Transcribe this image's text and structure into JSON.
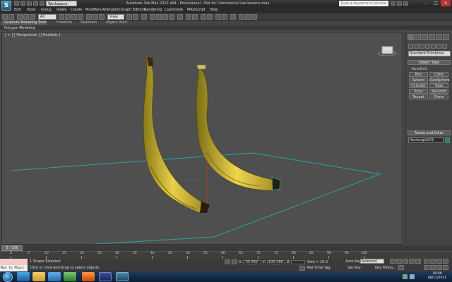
{
  "window": {
    "title": "Autodesk 3ds Max 2012 x64 - Educational - Not for Commercial Use   banana.max",
    "workspace": "Workspace: Default",
    "search_placeholder": "Type a keyword or phrase"
  },
  "menu": [
    "Edit",
    "Tools",
    "Group",
    "Views",
    "Create",
    "Modifiers",
    "Animation",
    "Graph Editors",
    "Rendering",
    "Customize",
    "MAXScript",
    "Help"
  ],
  "toolbar": {
    "selection_filter": "All",
    "reference_coord": "View"
  },
  "ribbon": {
    "tabs": [
      "Graphite Modeling Tools",
      "Freeform",
      "Selection",
      "Object Paint"
    ],
    "panel_label": "Polygon Modeling"
  },
  "viewport": {
    "label": "[ + ] [ Perspective ] [ Realistic ]"
  },
  "command_panel": {
    "category": "Standard Primitives",
    "object_type_header": "Object Type",
    "autogrid_label": "AutoGrid",
    "primitives": [
      "Box",
      "Cone",
      "Sphere",
      "GeoSphere",
      "Cylinder",
      "Tube",
      "Torus",
      "Pyramid",
      "Teapot",
      "Plane"
    ],
    "name_color_header": "Name and Color",
    "object_name": "Rectangle001",
    "swatch_color": "#1c8a5e"
  },
  "timeline": {
    "slider_label": "0 / 100",
    "ticks": [
      "0",
      "5",
      "10",
      "15",
      "20",
      "25",
      "30",
      "35",
      "40",
      "45",
      "50",
      "55",
      "60",
      "65",
      "70",
      "75",
      "80",
      "85",
      "90",
      "95",
      "100"
    ]
  },
  "status": {
    "maxscript_text": "Max to Physc",
    "selection_count": "1 Shape Selected",
    "prompt": "Click or click-and-drag to select objects",
    "x_value": "-35.435",
    "y_value": "105.486",
    "grid": "Grid = 10.0",
    "auto_key": "Auto Key",
    "set_key": "Set Key",
    "selected": "Selected",
    "key_filters": "Key Filters...",
    "add_time_tag": "Add Time Tag"
  },
  "taskbar": {
    "time": "18:09",
    "date": "08/11/2011"
  }
}
